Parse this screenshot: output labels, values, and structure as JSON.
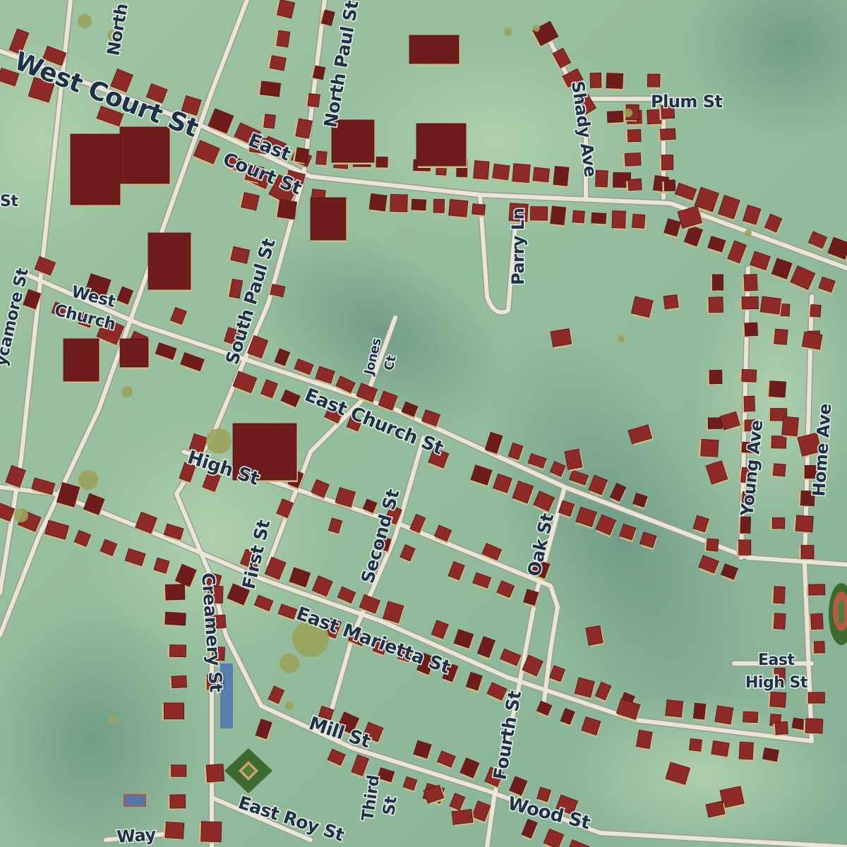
{
  "map": {
    "colors": {
      "terrain_light": "#9cc6a4",
      "terrain_dark": "#6f9a85",
      "road": "#e9e6d8",
      "building": "#8e2a27",
      "building_dark": "#6e1d1c",
      "building_roof_shadow": "#d2b884",
      "label": "#1f3146",
      "tree": "#9aa35a",
      "ballfield": "#3d6b2e"
    },
    "labels": {
      "west_court_st": "West Court St",
      "east_court_st_1": "East",
      "east_court_st_2": "Court St",
      "north_paul_st": "North Paul St",
      "north_top": "North",
      "south_paul_st": "South Paul St",
      "west_church_1": "West",
      "west_church_2": "Church",
      "sycamore_st": "ycamore St",
      "st_left": "St",
      "jones_ct_1": "Jones",
      "jones_ct_2": "Ct",
      "east_church_st": "East Church St",
      "high_st": "High St",
      "first_st": "First St",
      "second_st": "Second St",
      "oak_st": "Oak St",
      "creamery_st": "Creamery St",
      "east_marietta_st": "East Marietta St",
      "mill_st": "Mill St",
      "fourth_st": "Fourth St",
      "third_st_1": "Third",
      "third_st_2": "St",
      "east_roy_st": "East Roy St",
      "wood_st": "Wood St",
      "way": "Way",
      "shady_ave": "Shady Ave",
      "plum_st": "Plum St",
      "parry_ln": "Parry Ln",
      "young_ave": "Young Ave",
      "home_ave": "Home Ave",
      "east_high_st_1": "East",
      "east_high_st_2": "High St"
    }
  }
}
